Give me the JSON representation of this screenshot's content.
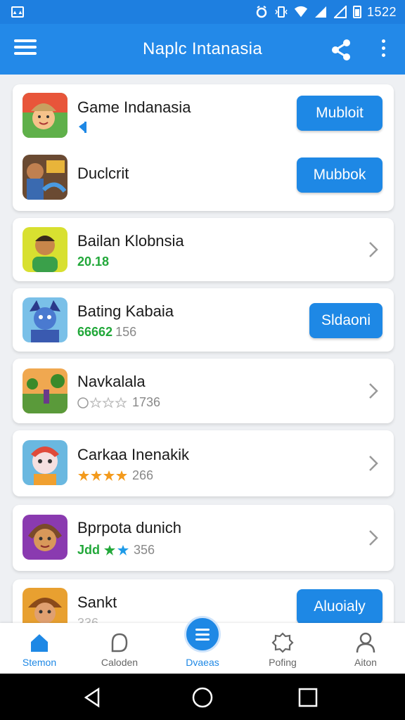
{
  "status_bar": {
    "time": "1522",
    "icons": [
      "notification-icon",
      "alarm-icon",
      "vibrate-icon",
      "wifi-icon",
      "signal-icon",
      "signal-icon",
      "battery-icon"
    ]
  },
  "app_bar": {
    "title": "Naplc Intanasia",
    "icons": [
      "menu-icon",
      "share-icon",
      "more-vert-icon"
    ]
  },
  "items": [
    {
      "name": "Game Indanasia",
      "button": "Mubloit",
      "sub_icon": "telegram-icon"
    },
    {
      "name": "Duclcrit",
      "button": "Mubbok"
    },
    {
      "name": "Bailan Klobnsia",
      "sub_green": "20.18",
      "action": "chevron-right-icon"
    },
    {
      "name": "Bating Kabaia",
      "sub_green": "66662",
      "sub_count": "156",
      "button": "Sldaoni"
    },
    {
      "name": "Navkalala",
      "sub_count": "1736",
      "rating": 0,
      "action": "chevron-right-icon"
    },
    {
      "name": "Carkaa Inenakik",
      "sub_count": "266",
      "rating": 4,
      "action": "chevron-right-icon"
    },
    {
      "name": "Bprpota dunich",
      "sub_green": "Jdd",
      "sub_count": "356",
      "rating": 3,
      "action": "chevron-right-icon"
    },
    {
      "name": "Sankt",
      "sub_count": "336",
      "button": "Aluoialy"
    }
  ],
  "bottom_nav": [
    {
      "label": "Stemon",
      "icon": "home-icon",
      "active": true
    },
    {
      "label": "Caloden",
      "icon": "chat-bubble-icon"
    },
    {
      "label": "Dvaeas",
      "icon": "menu-lines-icon",
      "fab": true
    },
    {
      "label": "Pofing",
      "icon": "badge-icon"
    },
    {
      "label": "Aiton",
      "icon": "person-icon"
    }
  ],
  "system_nav": [
    "back-icon",
    "home-circle-icon",
    "recents-icon"
  ],
  "colors": {
    "primary": "#2389e8",
    "button": "#1e88e5",
    "green": "#22a83a",
    "star_orange": "#f39a1c",
    "star_blue": "#1e9be8"
  }
}
